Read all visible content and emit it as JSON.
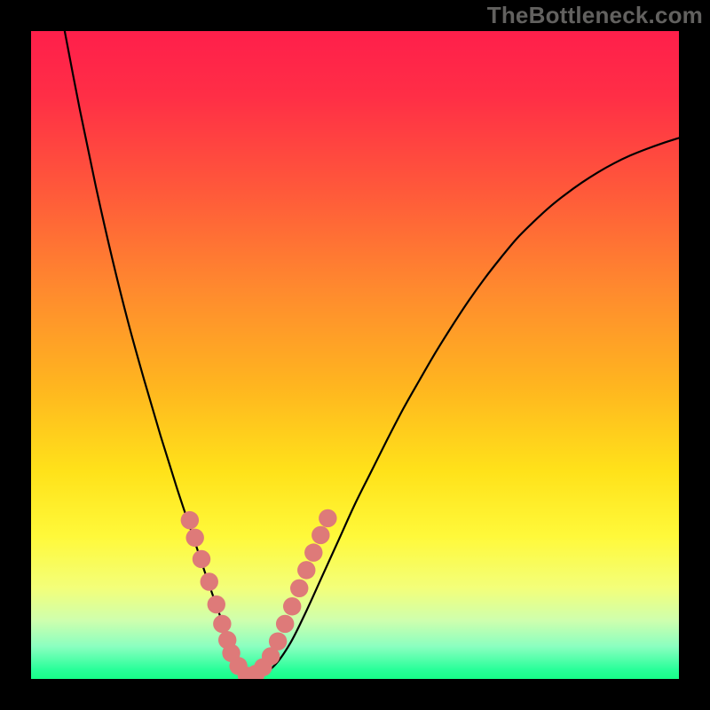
{
  "watermark": "TheBottleneck.com",
  "plot": {
    "inner_x": 35,
    "inner_y": 35,
    "inner_w": 730,
    "inner_h": 730
  },
  "chart_data": {
    "type": "line",
    "title": "",
    "xlabel": "",
    "ylabel": "",
    "xlim": [
      0,
      1
    ],
    "ylim": [
      0,
      1
    ],
    "vertex_x": 0.33,
    "series": [
      {
        "name": "bottleneck-curve",
        "x_norm": [
          0.05,
          0.075,
          0.1,
          0.125,
          0.15,
          0.175,
          0.2,
          0.225,
          0.25,
          0.275,
          0.3,
          0.325,
          0.35,
          0.375,
          0.4,
          0.425,
          0.45,
          0.475,
          0.5,
          0.525,
          0.55,
          0.575,
          0.6,
          0.625,
          0.65,
          0.675,
          0.7,
          0.725,
          0.75,
          0.775,
          0.8,
          0.825,
          0.85,
          0.875,
          0.9,
          0.925,
          0.95,
          0.975,
          1.0
        ],
        "y_norm": [
          1.01,
          0.88,
          0.76,
          0.65,
          0.55,
          0.46,
          0.375,
          0.295,
          0.22,
          0.145,
          0.075,
          0.015,
          0.005,
          0.02,
          0.055,
          0.105,
          0.16,
          0.215,
          0.27,
          0.32,
          0.37,
          0.418,
          0.462,
          0.505,
          0.545,
          0.583,
          0.618,
          0.65,
          0.68,
          0.705,
          0.728,
          0.748,
          0.766,
          0.782,
          0.796,
          0.808,
          0.818,
          0.827,
          0.835
        ]
      }
    ],
    "markers": {
      "name": "highlight-dots",
      "color": "#de7a79",
      "radius_norm": 0.014,
      "x_norm": [
        0.245,
        0.253,
        0.263,
        0.275,
        0.286,
        0.295,
        0.303,
        0.309,
        0.32,
        0.333,
        0.347,
        0.358,
        0.37,
        0.381,
        0.392,
        0.403,
        0.414,
        0.425,
        0.436,
        0.447,
        0.458
      ],
      "y_norm": [
        0.245,
        0.218,
        0.185,
        0.15,
        0.115,
        0.085,
        0.06,
        0.04,
        0.02,
        0.005,
        0.008,
        0.018,
        0.035,
        0.058,
        0.085,
        0.112,
        0.14,
        0.168,
        0.195,
        0.222,
        0.248
      ]
    },
    "gradient_stops": [
      {
        "offset": 0.0,
        "color": "#ff1f4b"
      },
      {
        "offset": 0.1,
        "color": "#ff2e46"
      },
      {
        "offset": 0.25,
        "color": "#ff5a3a"
      },
      {
        "offset": 0.4,
        "color": "#ff8a2e"
      },
      {
        "offset": 0.55,
        "color": "#ffb61f"
      },
      {
        "offset": 0.68,
        "color": "#ffe21a"
      },
      {
        "offset": 0.78,
        "color": "#fff93a"
      },
      {
        "offset": 0.86,
        "color": "#f3ff7a"
      },
      {
        "offset": 0.91,
        "color": "#ceffae"
      },
      {
        "offset": 0.95,
        "color": "#8affc0"
      },
      {
        "offset": 0.985,
        "color": "#2aff9a"
      },
      {
        "offset": 1.0,
        "color": "#17ff88"
      }
    ]
  }
}
